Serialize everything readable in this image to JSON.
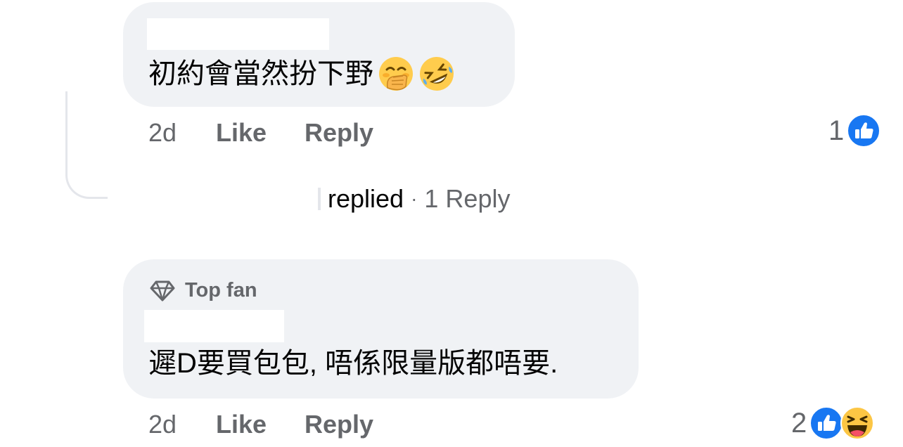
{
  "comments": [
    {
      "text": "初約會當然扮下野",
      "emojis": [
        "hand-over-mouth-emoji",
        "rolling-on-floor-laughing-emoji"
      ],
      "time": "2d",
      "like_label": "Like",
      "reply_label": "Reply",
      "reaction_count": "1",
      "reactions": [
        "like-reaction-icon"
      ]
    },
    {
      "badge": "Top fan",
      "badge_icon": "diamond-icon",
      "text": "遲D要買包包, 唔係限量版都唔要.",
      "time": "2d",
      "like_label": "Like",
      "reply_label": "Reply",
      "reaction_count": "2",
      "reactions": [
        "like-reaction-icon",
        "haha-reaction-icon"
      ]
    }
  ],
  "reply_summary": {
    "replied": "replied",
    "separator": "·",
    "count": "1 Reply"
  },
  "colors": {
    "bubble": "#f0f2f5",
    "secondary_text": "#65676b",
    "like_blue": "#1877f2",
    "thread_line": "#e4e6eb"
  }
}
